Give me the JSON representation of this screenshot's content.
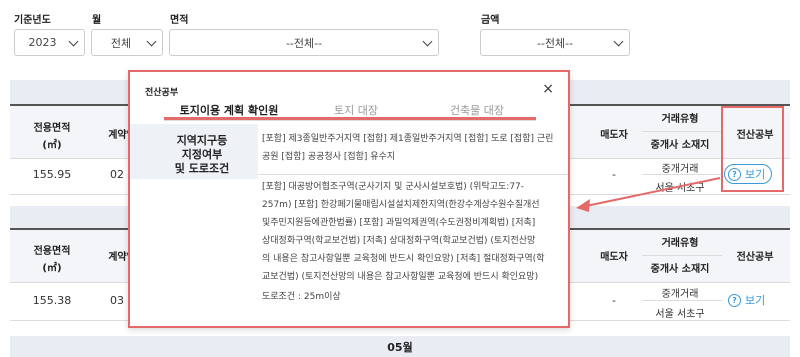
{
  "filters": {
    "year_label": "기준년도",
    "year_value": "2023",
    "month_label": "월",
    "month_value": "전체",
    "area_label": "면적",
    "area_value": "--전체--",
    "price_label": "금액",
    "price_value": "--전체--"
  },
  "table": {
    "headers": {
      "area": "전용면적",
      "area_unit": "(㎡)",
      "contract": "계약일",
      "seller": "매도자",
      "trade_type": "거래유형",
      "broker_location": "중개사 소재지",
      "ledger": "전산공부"
    },
    "rows": [
      {
        "area": "155.95",
        "contract": "02",
        "seller": "-",
        "trade_type": "중개거래",
        "broker_location": "서울 서초구",
        "view_label": "보기"
      },
      {
        "area": "155.38",
        "contract": "03",
        "seller": "-",
        "trade_type": "중개거래",
        "broker_location": "서울 서초구",
        "view_label": "보기"
      }
    ],
    "month_band": "05월"
  },
  "popup": {
    "title": "전산공부",
    "close": "×",
    "tabs": [
      "토지이용 계획 확인원",
      "토지 대장",
      "건축물 대장"
    ],
    "row_label_lines": [
      "지역지구등",
      "지정여부",
      "및 도로조건"
    ],
    "zone_lines": [
      "[포함] 제3종일반주거지역 [접함] 제1종일반주거지역 [접함] 도로 [접함] 근린",
      "공원 [접함] 공공청사 [접함] 유수지"
    ],
    "law_lines": [
      "[포함] 대공방어협조구역(군사기지 및 군사시설보호법) (위탁고도:77-",
      "257m) [포함] 한강폐기물매립시설설치제한지역(한강수계상수원수질개선",
      "및주민지원등에관한법률) [포함] 과밀억제권역(수도권정비계획법) [저촉]",
      "상대정화구역(학교보건법) [저촉] 상대정화구역(학교보건법) (토지전산망",
      "의 내용은 참고사항일뿐 교육청에 반드시 확인요망) [저촉] 절대정화구역(학",
      "교보건법) (토지전산망의 내용은 참고사항일뿐 교육청에 반드시 확인요망)"
    ],
    "road_condition": "도로조건 : 25m이상"
  },
  "colors": {
    "highlight": "#e46a6a",
    "accent": "#3a9ad9",
    "band": "#e9edf3"
  }
}
